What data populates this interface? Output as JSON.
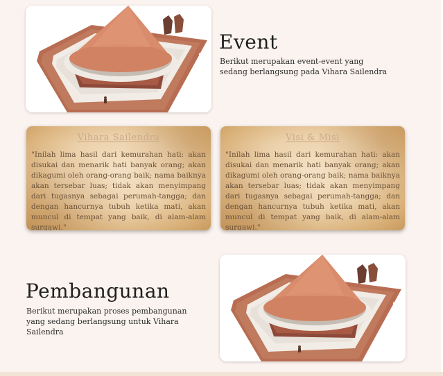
{
  "event": {
    "title": "Event",
    "description": "Berikut merupakan event-event yang sedang berlangsung pada Vihara Sailendra"
  },
  "cards": [
    {
      "title": "Vihara Sailendra",
      "body": "\"Inilah lima hasil dari kemurahan hati: akan disukai dan menarik hati banyak orang; akan dikagumi oleh orang-orang baik; nama baiknya akan tersebar luas; tidak akan menyimpang dari tugasnya sebagai perumah-tangga; dan dengan hancurnya tubuh ketika mati, akan muncul di tempat yang baik, di alam-alam surgawi.\""
    },
    {
      "title": "Visi & Misi",
      "body": "\"Inilah lima hasil dari kemurahan hati: akan disukai dan menarik hati banyak orang; akan dikagumi oleh orang-orang baik; nama baiknya akan tersebar luas; tidak akan menyimpang dari tugasnya sebagai perumah-tangga; dan dengan hancurnya tubuh ketika mati, akan muncul di tempat yang baik, di alam-alam surgawi.\""
    }
  ],
  "pembangunan": {
    "title": "Pembangunan",
    "description": "Berikut merupakan proses pembangunan yang sedang berlangsung untuk Vihara Sailendra"
  },
  "icons": {
    "prev": "chevron-left-icon",
    "next": "chevron-right-icon"
  },
  "colors": {
    "background": "#fbf3ef",
    "dome": "#d98c6c",
    "ground": "#b46a4f",
    "card_title": "#c9a98a"
  }
}
